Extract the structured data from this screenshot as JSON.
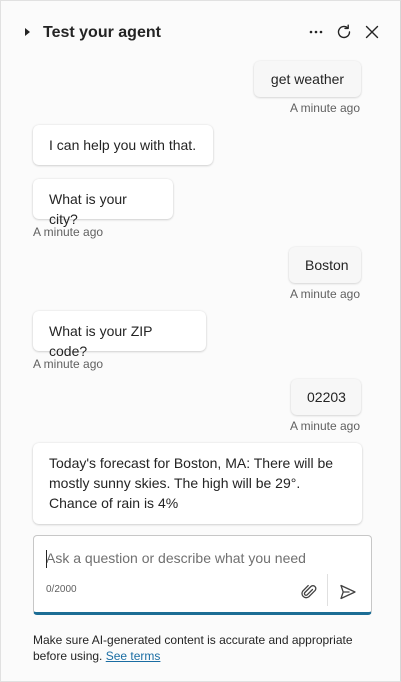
{
  "header": {
    "title": "Test your agent",
    "icons": {
      "collapse": "caret-right-icon",
      "more": "more-horizontal-icon",
      "refresh": "refresh-icon",
      "close": "close-icon"
    }
  },
  "messages": [
    {
      "role": "user",
      "text": "get weather",
      "timestamp": "A minute ago"
    },
    {
      "role": "agent",
      "text": "I can help you with that."
    },
    {
      "role": "agent",
      "text": "What is your city?",
      "timestamp": "A minute ago"
    },
    {
      "role": "user",
      "text": "Boston",
      "timestamp": "A minute ago"
    },
    {
      "role": "agent",
      "text": "What is your ZIP code?",
      "timestamp": "A minute ago"
    },
    {
      "role": "user",
      "text": "02203",
      "timestamp": "A minute ago"
    },
    {
      "role": "agent",
      "text": "Today's forecast for Boston, MA: There will be mostly sunny skies. The high will be 29°. Chance of rain is 4%"
    }
  ],
  "composer": {
    "placeholder": "Ask a question or describe what you need",
    "value": "",
    "counter": "0/2000",
    "icons": {
      "attach": "paperclip-icon",
      "send": "send-icon"
    }
  },
  "disclaimer": {
    "text": "Make sure AI-generated content is accurate and appropriate before using.",
    "link_label": "See terms"
  },
  "colors": {
    "accent": "#1c6d95",
    "link": "#1a6da3"
  }
}
